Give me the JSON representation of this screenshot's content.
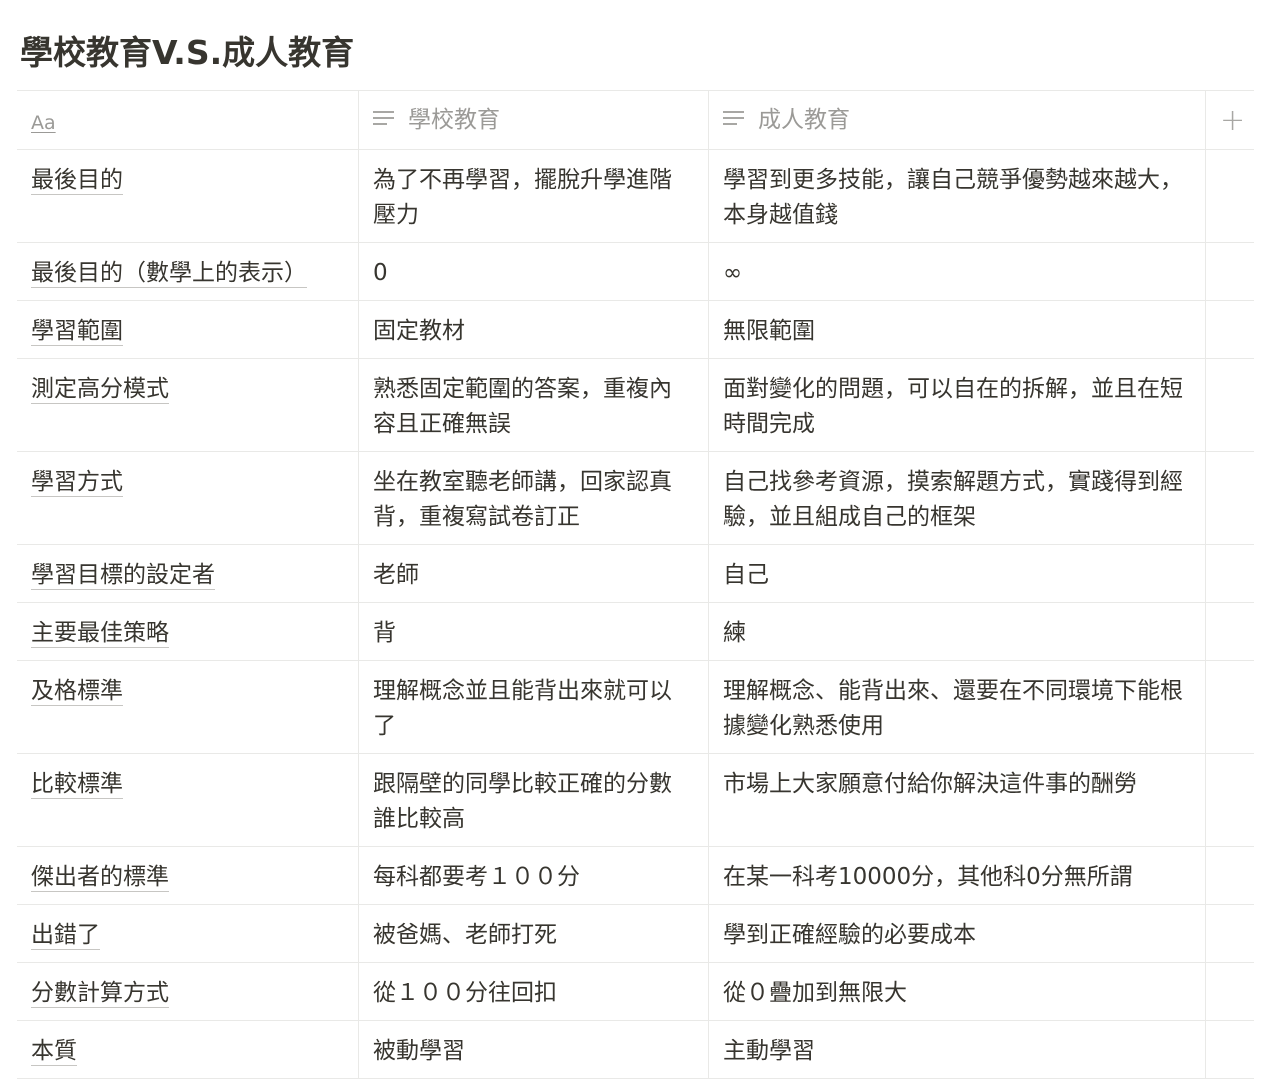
{
  "page_title": "學校教育V.S.成人教育",
  "header": {
    "name_icon": "Aa",
    "col2_icon": "text-property-icon",
    "col2": "學校教育",
    "col3_icon": "text-property-icon",
    "col3": "成人教育",
    "add_column": "+"
  },
  "rows": [
    {
      "name": "最後目的",
      "school": "為了不再學習，擺脫升學進階壓力",
      "adult": "學習到更多技能，讓自己競爭優勢越來越大，本身越值錢"
    },
    {
      "name": "最後目的（數學上的表示）",
      "school": "0",
      "adult": "∞"
    },
    {
      "name": "學習範圍",
      "school": "固定教材",
      "adult": "無限範圍"
    },
    {
      "name": "測定高分模式",
      "school": "熟悉固定範圍的答案，重複內容且正確無誤",
      "adult": "面對變化的問題，可以自在的拆解，並且在短時間完成"
    },
    {
      "name": "學習方式",
      "school": "坐在教室聽老師講，回家認真背，重複寫試卷訂正",
      "adult": "自己找參考資源，摸索解題方式，實踐得到經驗，並且組成自己的框架"
    },
    {
      "name": "學習目標的設定者",
      "school": "老師",
      "adult": "自己"
    },
    {
      "name": "主要最佳策略",
      "school": "背",
      "adult": "練"
    },
    {
      "name": "及格標準",
      "school": "理解概念並且能背出來就可以了",
      "adult": "理解概念、能背出來、還要在不同環境下能根據變化熟悉使用"
    },
    {
      "name": "比較標準",
      "school": "跟隔壁的同學比較正確的分數誰比較高",
      "adult": "市場上大家願意付給你解決這件事的酬勞"
    },
    {
      "name": "傑出者的標準",
      "school": "每科都要考１００分",
      "adult": "在某一科考10000分，其他科0分無所謂"
    },
    {
      "name": "出錯了",
      "school": "被爸媽、老師打死",
      "adult": "學到正確經驗的必要成本"
    },
    {
      "name": "分數計算方式",
      "school": "從１００分往回扣",
      "adult": "從０疊加到無限大"
    },
    {
      "name": "本質",
      "school": "被動學習",
      "adult": "主動學習"
    }
  ]
}
